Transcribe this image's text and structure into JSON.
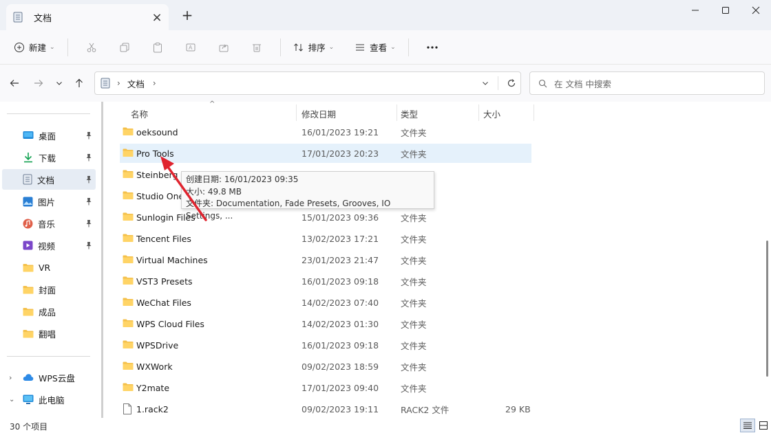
{
  "tab": {
    "title": "文档"
  },
  "toolbar": {
    "new_label": "新建",
    "sort_label": "排序",
    "view_label": "查看"
  },
  "address": {
    "crumb": "文档",
    "search_placeholder": "在 文档 中搜索"
  },
  "sidebar": {
    "quick": [
      {
        "label": "桌面",
        "icon": "desktop-icon",
        "pinned": true
      },
      {
        "label": "下载",
        "icon": "download-icon",
        "pinned": true
      },
      {
        "label": "文档",
        "icon": "documents-icon",
        "pinned": true,
        "selected": true
      },
      {
        "label": "图片",
        "icon": "pictures-icon",
        "pinned": true
      },
      {
        "label": "音乐",
        "icon": "music-icon",
        "pinned": true
      },
      {
        "label": "视频",
        "icon": "videos-icon",
        "pinned": true
      },
      {
        "label": "VR",
        "icon": "folder-icon"
      },
      {
        "label": "封面",
        "icon": "folder-icon"
      },
      {
        "label": "成品",
        "icon": "folder-icon"
      },
      {
        "label": "翻唱",
        "icon": "folder-icon"
      }
    ],
    "drives": [
      {
        "label": "WPS云盘",
        "icon": "cloud-icon",
        "expanded": false
      },
      {
        "label": "此电脑",
        "icon": "computer-icon",
        "expanded": true
      }
    ]
  },
  "columns": {
    "name": "名称",
    "date": "修改日期",
    "type": "类型",
    "size": "大小"
  },
  "files": [
    {
      "name": "oeksound",
      "date": "16/01/2023 19:21",
      "type": "文件夹",
      "size": ""
    },
    {
      "name": "Pro Tools",
      "date": "17/01/2023 20:23",
      "type": "文件夹",
      "size": "",
      "selected": true
    },
    {
      "name": "Steinberg",
      "date": "",
      "type": "",
      "size": ""
    },
    {
      "name": "Studio One",
      "date": "",
      "type": "",
      "size": ""
    },
    {
      "name": "Sunlogin Files",
      "date": "15/01/2023 09:36",
      "type": "文件夹",
      "size": ""
    },
    {
      "name": "Tencent Files",
      "date": "13/02/2023 17:21",
      "type": "文件夹",
      "size": ""
    },
    {
      "name": "Virtual Machines",
      "date": "23/01/2023 21:47",
      "type": "文件夹",
      "size": ""
    },
    {
      "name": "VST3 Presets",
      "date": "16/01/2023 09:18",
      "type": "文件夹",
      "size": ""
    },
    {
      "name": "WeChat Files",
      "date": "14/02/2023 07:40",
      "type": "文件夹",
      "size": ""
    },
    {
      "name": "WPS Cloud Files",
      "date": "14/02/2023 01:30",
      "type": "文件夹",
      "size": ""
    },
    {
      "name": "WPSDrive",
      "date": "16/01/2023 09:18",
      "type": "文件夹",
      "size": ""
    },
    {
      "name": "WXWork",
      "date": "09/02/2023 18:59",
      "type": "文件夹",
      "size": ""
    },
    {
      "name": "Y2mate",
      "date": "17/01/2023 09:40",
      "type": "文件夹",
      "size": ""
    },
    {
      "name": "1.rack2",
      "date": "09/02/2023 19:11",
      "type": "RACK2 文件",
      "size": "29 KB",
      "file": true
    }
  ],
  "tooltip": {
    "line1": "创建日期: 16/01/2023 09:35",
    "line2": "大小: 49.8 MB",
    "line3": "文件夹: Documentation, Fade Presets, Grooves, IO Settings, ..."
  },
  "status": {
    "count": "30 个项目"
  },
  "colors": {
    "accent": "#0067c0",
    "folder": "#f4c04a",
    "arrow": "#e0242f",
    "selection": "#e5f1fb"
  }
}
